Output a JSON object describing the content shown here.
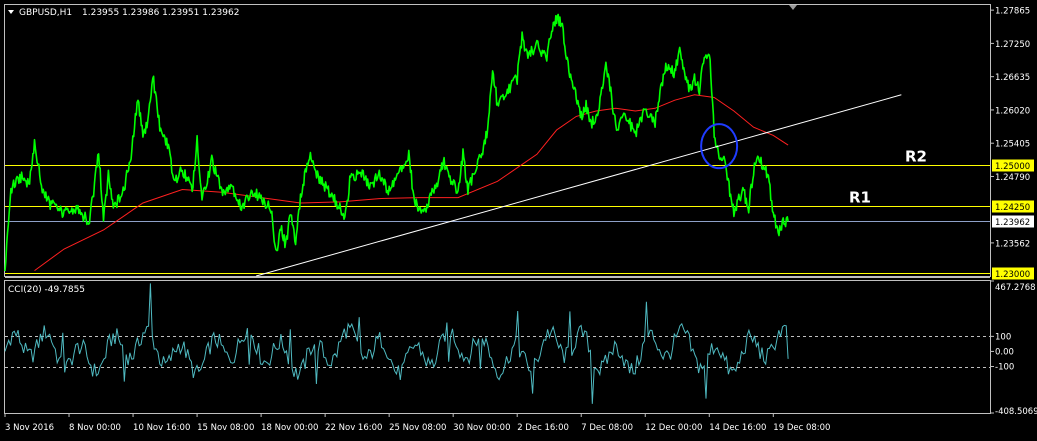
{
  "header": {
    "symbol_label": "GBPUSD,H1",
    "ohlc_label": "1.23955 1.23986 1.23951 1.23962"
  },
  "indicator": {
    "label": "CCI(20) -49.7855"
  },
  "colors": {
    "background": "#000000",
    "frame": "#c0c0c0",
    "price_line": "#00ff00",
    "moving_average": "#ff2020",
    "trendline": "#ffffff",
    "levels": "#ffff00",
    "current_price_line": "#8ea0c8",
    "cci_line": "#4fb9c0",
    "highlight_circle": "#1f3cff"
  },
  "chart_data": [
    {
      "type": "line",
      "title": "GBPUSD,H1",
      "series": [],
      "y_ticks": [
        "1.27865",
        "1.27250",
        "1.26635",
        "1.26020",
        "1.25405",
        "1.24790",
        "1.23562"
      ],
      "ylim": [
        1.2295,
        1.2796
      ],
      "x_ticks": [
        "3 Nov 2016",
        "8 Nov 00:00",
        "10 Nov 16:00",
        "15 Nov 08:00",
        "18 Nov 00:00",
        "22 Nov 16:00",
        "25 Nov 08:00",
        "30 Nov 00:00",
        "2 Dec 16:00",
        "7 Dec 08:00",
        "12 Dec 00:00",
        "14 Dec 16:00",
        "19 Dec 08:00"
      ],
      "price_path": [
        [
          0,
          1.2305
        ],
        [
          0.006,
          1.2455
        ],
        [
          0.015,
          1.2478
        ],
        [
          0.025,
          1.2468
        ],
        [
          0.03,
          1.2545
        ],
        [
          0.037,
          1.2462
        ],
        [
          0.045,
          1.243
        ],
        [
          0.06,
          1.241
        ],
        [
          0.075,
          1.242
        ],
        [
          0.085,
          1.2392
        ],
        [
          0.09,
          1.245
        ],
        [
          0.095,
          1.2525
        ],
        [
          0.1,
          1.24
        ],
        [
          0.105,
          1.248
        ],
        [
          0.11,
          1.242
        ],
        [
          0.12,
          1.245
        ],
        [
          0.128,
          1.252
        ],
        [
          0.135,
          1.2625
        ],
        [
          0.14,
          1.255
        ],
        [
          0.145,
          1.2582
        ],
        [
          0.15,
          1.2668
        ],
        [
          0.158,
          1.256
        ],
        [
          0.165,
          1.254
        ],
        [
          0.172,
          1.247
        ],
        [
          0.18,
          1.249
        ],
        [
          0.19,
          1.2455
        ],
        [
          0.195,
          1.2545
        ],
        [
          0.2,
          1.2432
        ],
        [
          0.21,
          1.251
        ],
        [
          0.22,
          1.245
        ],
        [
          0.23,
          1.2465
        ],
        [
          0.24,
          1.242
        ],
        [
          0.25,
          1.245
        ],
        [
          0.26,
          1.244
        ],
        [
          0.27,
          1.242
        ],
        [
          0.275,
          1.2335
        ],
        [
          0.28,
          1.239
        ],
        [
          0.285,
          1.235
        ],
        [
          0.29,
          1.241
        ],
        [
          0.295,
          1.235
        ],
        [
          0.3,
          1.244
        ],
        [
          0.305,
          1.249
        ],
        [
          0.31,
          1.2515
        ],
        [
          0.32,
          1.247
        ],
        [
          0.33,
          1.245
        ],
        [
          0.34,
          1.242
        ],
        [
          0.345,
          1.2395
        ],
        [
          0.35,
          1.247
        ],
        [
          0.36,
          1.249
        ],
        [
          0.37,
          1.246
        ],
        [
          0.38,
          1.248
        ],
        [
          0.39,
          1.245
        ],
        [
          0.4,
          1.249
        ],
        [
          0.41,
          1.252
        ],
        [
          0.415,
          1.244
        ],
        [
          0.42,
          1.242
        ],
        [
          0.425,
          1.241
        ],
        [
          0.43,
          1.2435
        ],
        [
          0.44,
          1.247
        ],
        [
          0.445,
          1.251
        ],
        [
          0.45,
          1.248
        ],
        [
          0.46,
          1.245
        ],
        [
          0.465,
          1.252
        ],
        [
          0.47,
          1.245
        ],
        [
          0.48,
          1.251
        ],
        [
          0.485,
          1.253
        ],
        [
          0.49,
          1.2565
        ],
        [
          0.495,
          1.268
        ],
        [
          0.5,
          1.261
        ],
        [
          0.51,
          1.2635
        ],
        [
          0.52,
          1.266
        ],
        [
          0.525,
          1.274
        ],
        [
          0.53,
          1.27
        ],
        [
          0.54,
          1.272
        ],
        [
          0.55,
          1.27
        ],
        [
          0.555,
          1.275
        ],
        [
          0.56,
          1.277
        ],
        [
          0.565,
          1.2765
        ],
        [
          0.57,
          1.27
        ],
        [
          0.575,
          1.265
        ],
        [
          0.58,
          1.263
        ],
        [
          0.585,
          1.259
        ],
        [
          0.59,
          1.261
        ],
        [
          0.595,
          1.2575
        ],
        [
          0.6,
          1.259
        ],
        [
          0.605,
          1.2625
        ],
        [
          0.61,
          1.268
        ],
        [
          0.615,
          1.264
        ],
        [
          0.62,
          1.257
        ],
        [
          0.63,
          1.259
        ],
        [
          0.64,
          1.256
        ],
        [
          0.65,
          1.26
        ],
        [
          0.66,
          1.258
        ],
        [
          0.665,
          1.263
        ],
        [
          0.67,
          1.268
        ],
        [
          0.68,
          1.267
        ],
        [
          0.685,
          1.272
        ],
        [
          0.69,
          1.267
        ],
        [
          0.695,
          1.264
        ],
        [
          0.7,
          1.266
        ],
        [
          0.705,
          1.264
        ],
        [
          0.71,
          1.27
        ],
        [
          0.715,
          1.271
        ],
        [
          0.72,
          1.256
        ],
        [
          0.725,
          1.251
        ],
        [
          0.73,
          1.252
        ],
        [
          0.735,
          1.246
        ],
        [
          0.74,
          1.241
        ],
        [
          0.745,
          1.244
        ],
        [
          0.75,
          1.245
        ],
        [
          0.755,
          1.242
        ],
        [
          0.76,
          1.249
        ],
        [
          0.765,
          1.251
        ],
        [
          0.77,
          1.25
        ],
        [
          0.775,
          1.248
        ],
        [
          0.78,
          1.241
        ],
        [
          0.785,
          1.237
        ],
        [
          0.79,
          1.2395
        ],
        [
          0.795,
          1.2396
        ]
      ],
      "moving_average_path": [
        [
          0.03,
          1.2305
        ],
        [
          0.06,
          1.2345
        ],
        [
          0.1,
          1.238
        ],
        [
          0.14,
          1.243
        ],
        [
          0.18,
          1.2455
        ],
        [
          0.22,
          1.245
        ],
        [
          0.26,
          1.244
        ],
        [
          0.3,
          1.243
        ],
        [
          0.34,
          1.2432
        ],
        [
          0.38,
          1.2438
        ],
        [
          0.42,
          1.244
        ],
        [
          0.46,
          1.244
        ],
        [
          0.5,
          1.247
        ],
        [
          0.54,
          1.252
        ],
        [
          0.56,
          1.2565
        ],
        [
          0.58,
          1.259
        ],
        [
          0.6,
          1.26
        ],
        [
          0.62,
          1.2605
        ],
        [
          0.64,
          1.26
        ],
        [
          0.66,
          1.2605
        ],
        [
          0.68,
          1.262
        ],
        [
          0.7,
          1.263
        ],
        [
          0.72,
          1.2625
        ],
        [
          0.74,
          1.26
        ],
        [
          0.76,
          1.257
        ],
        [
          0.78,
          1.2555
        ],
        [
          0.795,
          1.2537
        ]
      ],
      "trendline": {
        "from": [
          0.255,
          1.2295
        ],
        "to": [
          0.91,
          1.263
        ]
      },
      "levels": [
        {
          "value": 1.25,
          "label": "1.25000",
          "tag": "R2"
        },
        {
          "value": 1.2425,
          "label": "1.24250",
          "tag": "R1"
        },
        {
          "value": 1.23,
          "label": "1.23000",
          "tag": ""
        }
      ],
      "current_price": {
        "value": 1.23962,
        "label": "1.23962"
      },
      "highlight": {
        "x": 0.725,
        "y": 1.2535
      },
      "annotations": [
        "R2",
        "R1"
      ]
    },
    {
      "type": "line",
      "title": "CCI(20) -49.7855",
      "series": [],
      "y_ticks": [
        "467.2768",
        "100",
        "0.00",
        "-100",
        "-408.5069"
      ],
      "ylim": [
        -408.5069,
        467.2768
      ],
      "reference_levels": [
        100,
        -100
      ],
      "last_value": -49.7855
    }
  ]
}
